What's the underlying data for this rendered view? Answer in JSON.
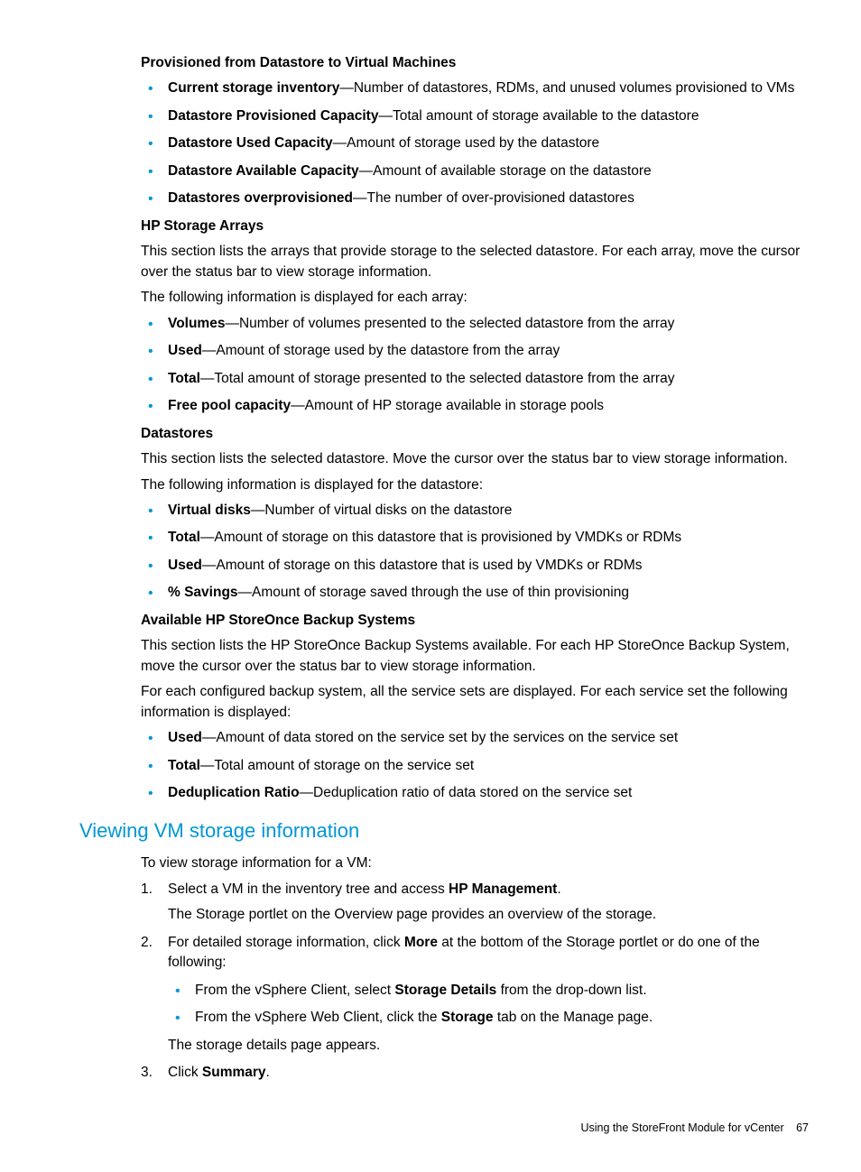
{
  "section1": {
    "heading": "Provisioned from Datastore to Virtual Machines",
    "items": [
      {
        "term": "Current storage inventory",
        "desc": "—Number of datastores, RDMs, and unused volumes provisioned to VMs"
      },
      {
        "term": "Datastore Provisioned Capacity",
        "desc": "—Total amount of storage available to the datastore"
      },
      {
        "term": "Datastore Used Capacity",
        "desc": "—Amount of storage used by the datastore"
      },
      {
        "term": "Datastore Available Capacity",
        "desc": "—Amount of available storage on the datastore"
      },
      {
        "term": "Datastores overprovisioned",
        "desc": "—The number of over-provisioned datastores"
      }
    ]
  },
  "section2": {
    "heading": "HP Storage Arrays",
    "para1": "This section lists the arrays that provide storage to the selected datastore. For each array, move the cursor over the status bar to view storage information.",
    "para2": "The following information is displayed for each array:",
    "items": [
      {
        "term": "Volumes",
        "desc": "—Number of volumes presented to the selected datastore from the array"
      },
      {
        "term": "Used",
        "desc": "—Amount of storage used by the datastore from the array"
      },
      {
        "term": "Total",
        "desc": "—Total amount of storage presented to the selected datastore from the array"
      },
      {
        "term": "Free pool capacity",
        "desc": "—Amount of HP storage available in storage pools"
      }
    ]
  },
  "section3": {
    "heading": "Datastores",
    "para1": "This section lists the selected datastore. Move the cursor over the status bar to view storage information.",
    "para2": "The following information is displayed for the datastore:",
    "items": [
      {
        "term": "Virtual disks",
        "desc": "—Number of virtual disks on the datastore"
      },
      {
        "term": "Total",
        "desc": "—Amount of storage on this datastore that is provisioned by VMDKs or RDMs"
      },
      {
        "term": "Used",
        "desc": "—Amount of storage on this datastore that is used by VMDKs or RDMs"
      },
      {
        "term": "% Savings",
        "desc": "—Amount of storage saved through the use of thin provisioning"
      }
    ]
  },
  "section4": {
    "heading": "Available HP StoreOnce Backup Systems",
    "para1": "This section lists the HP StoreOnce Backup Systems available. For each HP StoreOnce Backup System, move the cursor over the status bar to view storage information.",
    "para2": "For each configured backup system, all the service sets are displayed. For each service set the following information is displayed:",
    "items": [
      {
        "term": "Used",
        "desc": "—Amount of data stored on the service set by the services on the service set"
      },
      {
        "term": "Total",
        "desc": "—Total amount of storage on the service set"
      },
      {
        "term": "Deduplication Ratio",
        "desc": "—Deduplication ratio of data stored on the service set"
      }
    ]
  },
  "main_heading": "Viewing VM storage information",
  "intro": "To view storage information for a VM:",
  "steps": {
    "s1_pre": "Select a VM in the inventory tree and access ",
    "s1_bold": "HP Management",
    "s1_post": ".",
    "s1_sub": "The Storage portlet on the Overview page provides an overview of the storage.",
    "s2_pre": "For detailed storage information, click ",
    "s2_bold": "More",
    "s2_post": " at the bottom of the Storage portlet or do one of the following:",
    "s2_b1_pre": "From the vSphere Client, select ",
    "s2_b1_bold": "Storage Details",
    "s2_b1_post": " from the drop-down list.",
    "s2_b2_pre": "From the vSphere Web Client, click the ",
    "s2_b2_bold": "Storage",
    "s2_b2_post": " tab on the Manage page.",
    "s2_sub": "The storage details page appears.",
    "s3_pre": "Click ",
    "s3_bold": "Summary",
    "s3_post": "."
  },
  "footer": {
    "text": "Using the StoreFront Module for vCenter",
    "page": "67"
  }
}
